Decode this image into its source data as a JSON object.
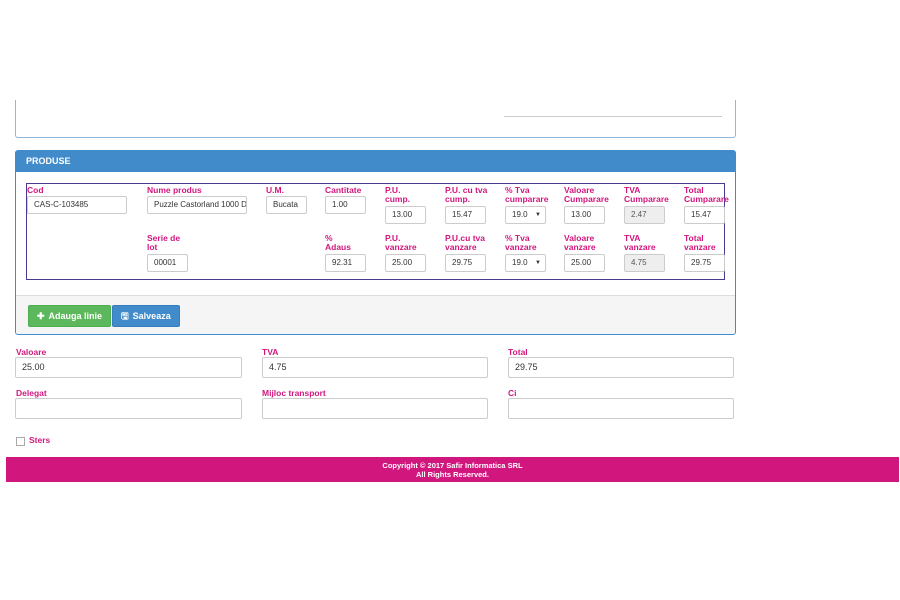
{
  "produse": {
    "title": "PRODUSE",
    "labels": {
      "cod": "Cod",
      "nume_produs": "Nume produs",
      "um": "U.M.",
      "cantitate": "Cantitate",
      "pu_cump": "P.U. cump.",
      "pu_tva_cump": "P.U. cu tva cump.",
      "tva_cumparare_pct": "% Tva cumparare",
      "valoare_cumparare": "Valoare Cumparare",
      "tva_cumparare": "TVA Cumparare",
      "total_cumparare": "Total Cumparare",
      "serie_lot": "Serie de lot",
      "adaus": "% Adaus",
      "pu_vanzare": "P.U. vanzare",
      "pu_tva_vanzare": "P.U.cu tva vanzare",
      "tva_vanzare_pct": "% Tva vanzare",
      "valoare_vanzare": "Valoare vanzare",
      "tva_vanzare": "TVA vanzare",
      "total_vanzare": "Total vanzare"
    },
    "values": {
      "cod": "CAS-C-103485",
      "nume_produs": "Puzzle Castorland 1000 D",
      "um": "Bucata",
      "cantitate": "1.00",
      "pu_cump": "13.00",
      "pu_tva_cump": "15.47",
      "tva_cumparare_pct": "19.0",
      "valoare_cumparare": "13.00",
      "tva_cumparare": "2.47",
      "total_cumparare": "15.47",
      "serie_lot": "00001",
      "adaus": "92.31",
      "pu_vanzare": "25.00",
      "pu_tva_vanzare": "29.75",
      "tva_vanzare_pct": "19.0",
      "valoare_vanzare": "25.00",
      "tva_vanzare": "4.75",
      "total_vanzare": "29.75"
    },
    "buttons": {
      "add_line": "Adauga linie",
      "save": "Salveaza"
    }
  },
  "summary": {
    "labels": {
      "valoare": "Valoare",
      "tva": "TVA",
      "total": "Total",
      "delegat": "Delegat",
      "mijloc_transport": "Mijloc transport",
      "ci": "Ci"
    },
    "values": {
      "valoare": "25.00",
      "tva": "4.75",
      "total": "29.75",
      "delegat": "",
      "mijloc_transport": "",
      "ci": ""
    }
  },
  "sters_label": "Sters",
  "footer": {
    "line1": "Copyright © 2017 Safir Informatica SRL",
    "line2": "All Rights Reserved."
  },
  "colors": {
    "accent": "#d1177e",
    "primary": "#428bca",
    "success": "#5cb85c"
  }
}
